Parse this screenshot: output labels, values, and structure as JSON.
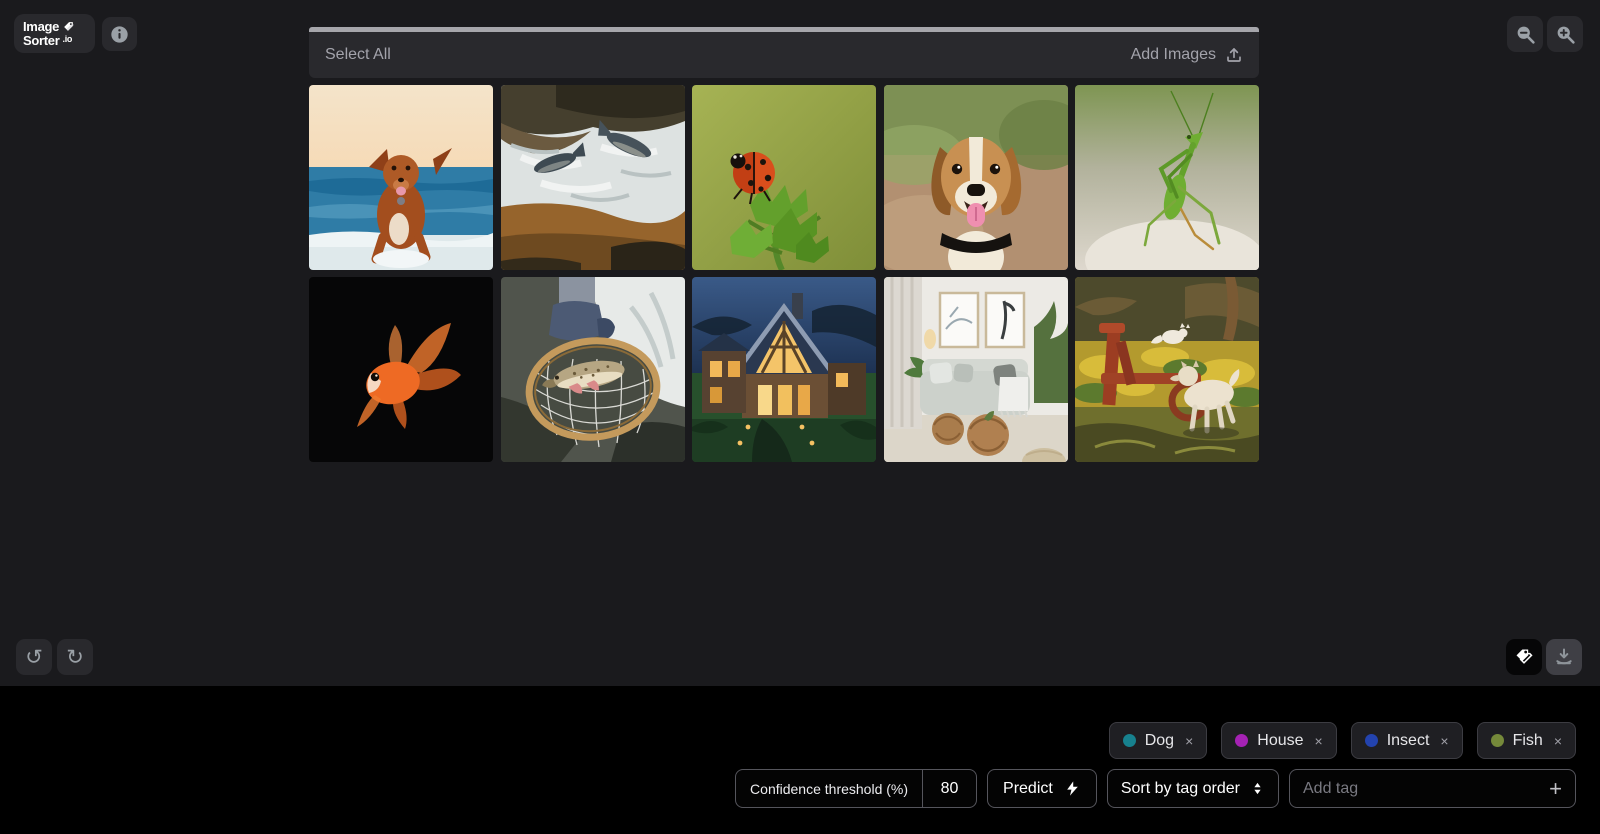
{
  "app": {
    "logo": {
      "line1": "Image",
      "line2": "Sorter",
      "suffix": ".io"
    }
  },
  "header": {
    "select_all": "Select All",
    "add_images": "Add Images"
  },
  "icons": {
    "undo": "↺",
    "redo": "↻",
    "tag_remove": "×",
    "add": "+"
  },
  "grid": {
    "images": [
      {
        "name": "dog-beach",
        "description": "Golden retriever dog running on a beach"
      },
      {
        "name": "salmon-rapids",
        "description": "Salmon leaping up white-water rapids"
      },
      {
        "name": "ladybug",
        "description": "Ladybug on a green spiky plant"
      },
      {
        "name": "beagle",
        "description": "Beagle dog face with tongue out"
      },
      {
        "name": "mantis",
        "description": "Green praying mantis"
      },
      {
        "name": "goldfish",
        "description": "Orange goldfish on black background"
      },
      {
        "name": "trout-net",
        "description": "Trout fish in a landing net held over a stream"
      },
      {
        "name": "house-dusk",
        "description": "Wooden house at dusk with lit windows"
      },
      {
        "name": "living-room",
        "description": "Bright living room with sofa and wooden tables"
      },
      {
        "name": "dog-field",
        "description": "Dog in an autumn field beside rusty farm equipment"
      }
    ]
  },
  "tags": {
    "items": [
      {
        "label": "Dog",
        "color": "#17818e"
      },
      {
        "label": "House",
        "color": "#a522b4"
      },
      {
        "label": "Insect",
        "color": "#2343ae"
      },
      {
        "label": "Fish",
        "color": "#75893a"
      }
    ]
  },
  "controls": {
    "confidence_label": "Confidence threshold (%)",
    "confidence_value": "80",
    "predict_label": "Predict",
    "sort_label": "Sort by tag order",
    "add_tag_placeholder": "Add tag"
  }
}
